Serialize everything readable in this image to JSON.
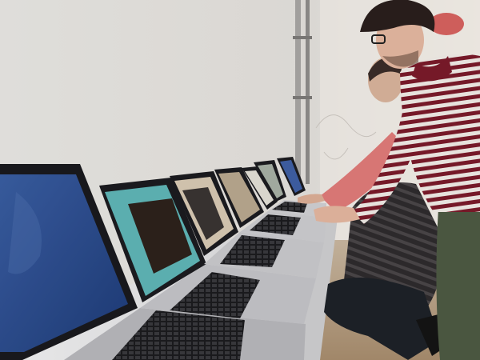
{
  "scene": {
    "kind": "photo",
    "subjects": [
      "laptop-row",
      "person-striped-shirt",
      "person-pink-sleeve"
    ],
    "colors": {
      "wall": "#e8e6e2",
      "wall_shadow": "#cfcac5",
      "table": "#e9e9ea",
      "laptop_silver": "#b9b9bd",
      "laptop_bezel": "#1a1a1e",
      "screen_blue": "#2c4f95",
      "screen_teal": "#5fb6b7",
      "screen_pale": "#d9c6aa",
      "keyboard": "#2a2a2d",
      "stripe_red": "#7a1b2a",
      "stripe_white": "#f1ece6",
      "pink_sleeve": "#e07b79",
      "pants_green": "#4e5a43",
      "hair": "#2a1f1d"
    }
  }
}
